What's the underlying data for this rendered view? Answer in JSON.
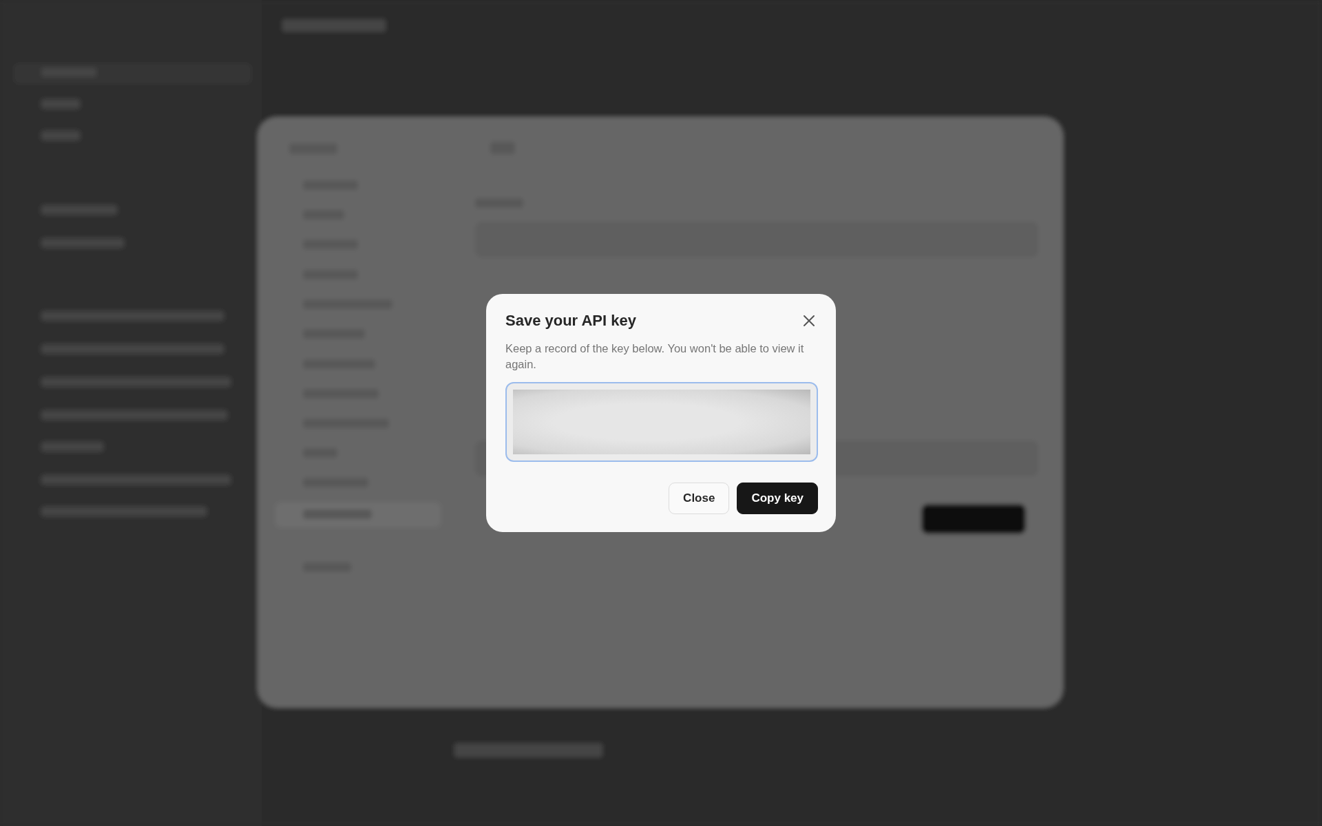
{
  "dialog": {
    "title": "Save your API key",
    "description": "Keep a record of the key below. You won't be able to view it again.",
    "key_field": {
      "obscured": true
    },
    "buttons": [
      {
        "label": "Close",
        "kind": "secondary"
      },
      {
        "label": "Copy key",
        "kind": "primary"
      }
    ]
  }
}
